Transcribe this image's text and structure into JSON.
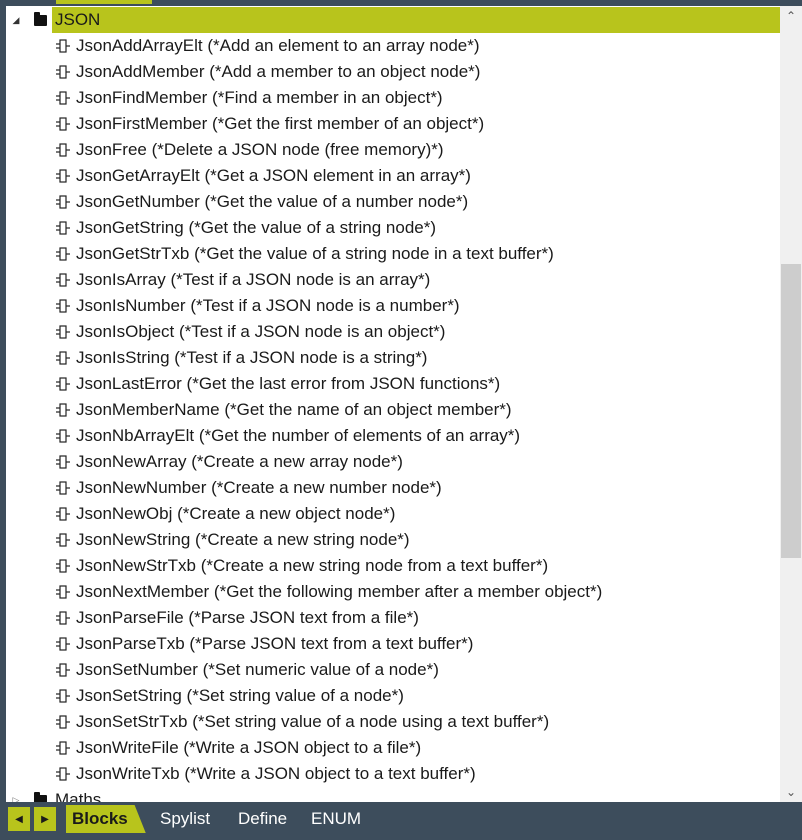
{
  "tree": {
    "category": {
      "label": "JSON",
      "expanded": true,
      "items": [
        {
          "label": "JsonAddArrayElt (*Add an element to an array node*)"
        },
        {
          "label": "JsonAddMember (*Add a member to an object node*)"
        },
        {
          "label": "JsonFindMember (*Find a member in an object*)"
        },
        {
          "label": "JsonFirstMember (*Get the first member of an object*)"
        },
        {
          "label": "JsonFree (*Delete a JSON node (free memory)*)"
        },
        {
          "label": "JsonGetArrayElt (*Get a JSON element in an array*)"
        },
        {
          "label": "JsonGetNumber (*Get the value of a number node*)"
        },
        {
          "label": "JsonGetString (*Get the value of a string node*)"
        },
        {
          "label": "JsonGetStrTxb (*Get the value of a string node in a text buffer*)"
        },
        {
          "label": "JsonIsArray (*Test if a JSON node is an array*)"
        },
        {
          "label": "JsonIsNumber (*Test if a JSON node is a number*)"
        },
        {
          "label": "JsonIsObject (*Test if a JSON node is an object*)"
        },
        {
          "label": "JsonIsString (*Test if a JSON node is a string*)"
        },
        {
          "label": "JsonLastError (*Get the last error from JSON functions*)"
        },
        {
          "label": "JsonMemberName (*Get the name of an object member*)"
        },
        {
          "label": "JsonNbArrayElt (*Get the number of elements of an array*)"
        },
        {
          "label": "JsonNewArray (*Create a new array node*)"
        },
        {
          "label": "JsonNewNumber (*Create a new number node*)"
        },
        {
          "label": "JsonNewObj (*Create a new object node*)"
        },
        {
          "label": "JsonNewString (*Create a new string node*)"
        },
        {
          "label": "JsonNewStrTxb (*Create a new string node from a text buffer*)"
        },
        {
          "label": "JsonNextMember (*Get the following member after a member object*)"
        },
        {
          "label": "JsonParseFile (*Parse JSON text from a file*)"
        },
        {
          "label": "JsonParseTxb (*Parse JSON text from a text buffer*)"
        },
        {
          "label": "JsonSetNumber (*Set numeric value of a node*)"
        },
        {
          "label": "JsonSetString (*Set string value of a node*)"
        },
        {
          "label": "JsonSetStrTxb (*Set string value of a node using a text buffer*)"
        },
        {
          "label": "JsonWriteFile (*Write a JSON object to a file*)"
        },
        {
          "label": "JsonWriteTxb (*Write a JSON object to a text buffer*)"
        }
      ]
    },
    "next_category": {
      "label": "Maths"
    }
  },
  "bottom_tabs": [
    {
      "label": "Blocks",
      "active": true
    },
    {
      "label": "Spylist",
      "active": false
    },
    {
      "label": "Define",
      "active": false
    },
    {
      "label": "ENUM",
      "active": false
    }
  ],
  "colors": {
    "accent": "#b8c41c",
    "frame": "#3d4d5c"
  }
}
